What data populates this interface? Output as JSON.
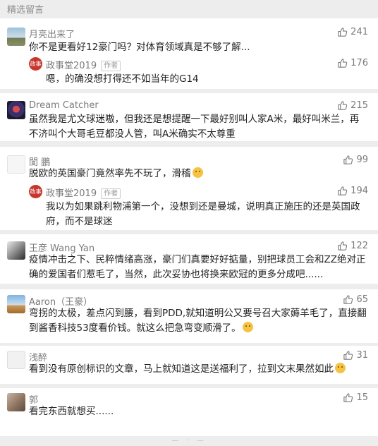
{
  "section_title": "精选留言",
  "colors": {
    "background": "#ededed",
    "card": "#ffffff",
    "muted": "#7b7b7b",
    "reply_badge": "#c8362e"
  },
  "comments": [
    {
      "author": "月亮出来了",
      "likes": "241",
      "text": "你不是更看好12豪门吗？对体育领域真是不够了解...",
      "reply": {
        "author": "政事堂2019",
        "tag": "作者",
        "likes": "176",
        "text": "嗯，的确没想打得还不如当年的G14"
      }
    },
    {
      "author": "Dream Catcher",
      "likes": "215",
      "text": "虽然我是尤文球迷嗷，但我还是想提醒一下最好别叫人家A米，最好叫米兰，再不济叫个大哥毛豆都没人管，叫A米确实不太尊重"
    },
    {
      "author": "閬 鵬",
      "likes": "99",
      "text": "脱欧的英国豪门竟然率先不玩了，滑稽",
      "reply": {
        "author": "政事堂2019",
        "tag": "作者",
        "likes": "194",
        "text": "我以为如果跳利物浦第一个，没想到还是曼城，说明真正施压的还是英国政府，而不是球迷"
      }
    },
    {
      "author": "王彦 Wang Yan",
      "likes": "122",
      "text": "疫情冲击之下、民粹情绪高涨，豪门们真要好好掂量，别把球员工会和ZZ绝对正确的爱国者们惹毛了，当然，此次妥协也将换来欧冠的更多分成吧......"
    },
    {
      "author": "Aaron（王豪）",
      "likes": "65",
      "text": "弯拐的太极，差点闪到腰，看到PDD,就知道明公又要号召大家薅羊毛了，直接翻到酱香科技53度看价钱。就这么把急弯变顺滑了。"
    },
    {
      "author": "浅醉",
      "likes": "31",
      "text": "看到没有原创标识的文章，马上就知道这是送福利了，拉到文末果然如此"
    },
    {
      "author": "郭",
      "likes": "15",
      "text": "看完东西就想买......"
    }
  ],
  "badge_text": "政事"
}
